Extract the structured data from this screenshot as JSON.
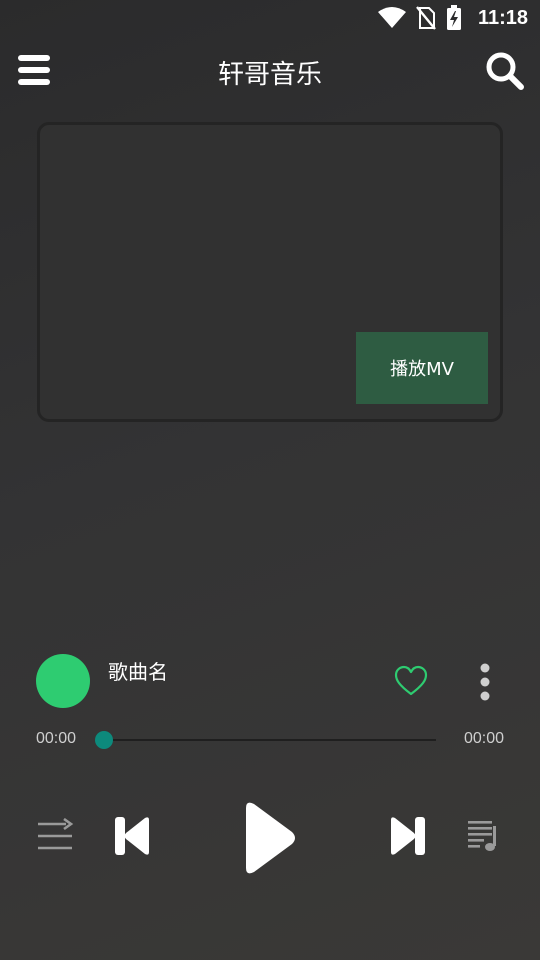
{
  "status_bar": {
    "time": "11:18",
    "icons": [
      "wifi-icon",
      "no-sim-icon",
      "battery-charging-icon"
    ]
  },
  "app_bar": {
    "title": "轩哥音乐",
    "menu_icon": "hamburger-menu-icon",
    "search_icon": "search-icon"
  },
  "mv_panel": {
    "play_mv_label": "播放MV",
    "button_color": "#2e5c42"
  },
  "now_playing": {
    "song_name": "歌曲名",
    "album_color": "#2ecc71",
    "like_icon": "heart-outline-icon",
    "more_icon": "more-vertical-icon"
  },
  "progress": {
    "current": "00:00",
    "total": "00:00",
    "fraction": 0,
    "accent": "#0d8a7c"
  },
  "controls": {
    "icons": [
      "shuffle-icon",
      "skip-previous-icon",
      "play-icon",
      "skip-next-icon",
      "playlist-icon"
    ]
  }
}
